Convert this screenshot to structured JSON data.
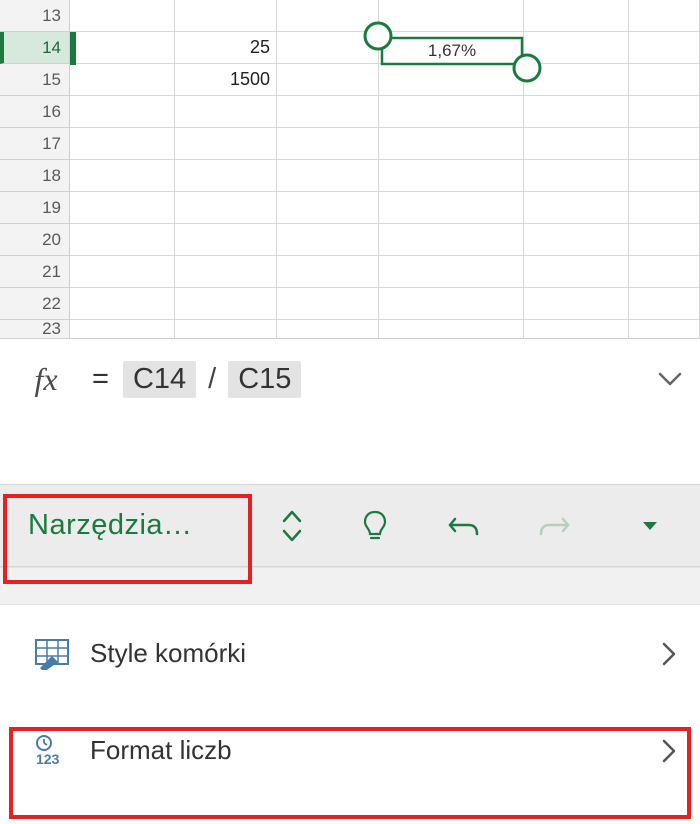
{
  "grid": {
    "rows": [
      {
        "num": "13"
      },
      {
        "num": "14",
        "c": "25",
        "selected": true
      },
      {
        "num": "15",
        "c": "1500"
      },
      {
        "num": "16"
      },
      {
        "num": "17"
      },
      {
        "num": "18"
      },
      {
        "num": "19"
      },
      {
        "num": "20"
      },
      {
        "num": "21"
      },
      {
        "num": "22"
      },
      {
        "num": "23"
      }
    ],
    "shape_label": "1,67%"
  },
  "formula": {
    "fx": "fx",
    "eq": "=",
    "ref1": "C14",
    "op": "/",
    "ref2": "C15"
  },
  "toolbar": {
    "tools_label": "Narzędzia…"
  },
  "panel": {
    "styles_label": "Style komórki",
    "format_label": "Format liczb"
  },
  "colors": {
    "accent": "#1a7a3f",
    "highlight_border": "#e52121"
  }
}
